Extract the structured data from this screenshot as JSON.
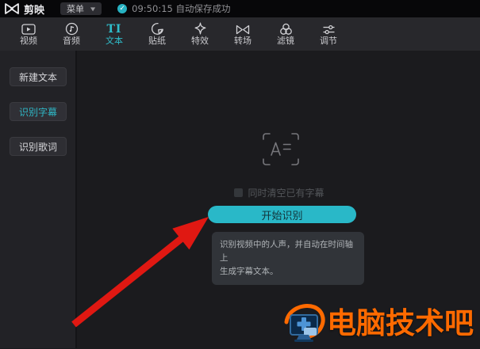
{
  "titlebar": {
    "app_name": "剪映",
    "menu_label": "菜单",
    "save_time": "09:50:15",
    "save_status": "自动保存成功"
  },
  "toolbar": {
    "text_icon_glyph": "TI",
    "tabs": [
      {
        "label": "视频",
        "active": false
      },
      {
        "label": "音频",
        "active": false
      },
      {
        "label": "文本",
        "active": true
      },
      {
        "label": "贴纸",
        "active": false
      },
      {
        "label": "特效",
        "active": false
      },
      {
        "label": "转场",
        "active": false
      },
      {
        "label": "滤镜",
        "active": false
      },
      {
        "label": "调节",
        "active": false
      }
    ]
  },
  "sidebar": {
    "items": [
      {
        "label": "新建文本",
        "active": false
      },
      {
        "label": "识别字幕",
        "active": true
      },
      {
        "label": "识别歌词",
        "active": false
      }
    ]
  },
  "recognize_panel": {
    "clear_checkbox_label": "同时清空已有字幕",
    "checkbox_checked": false,
    "start_button_label": "开始识别",
    "description_line1": "识别视频中的人声，并自动在时间轴上",
    "description_line2": "生成字幕文本。"
  },
  "watermark": {
    "site_name": "电脑技术吧"
  },
  "colors": {
    "accent_teal": "#29b8c8",
    "active_text": "#2fbecb",
    "watermark_orange": "#ff6a00",
    "arrow_red": "#e01812"
  }
}
